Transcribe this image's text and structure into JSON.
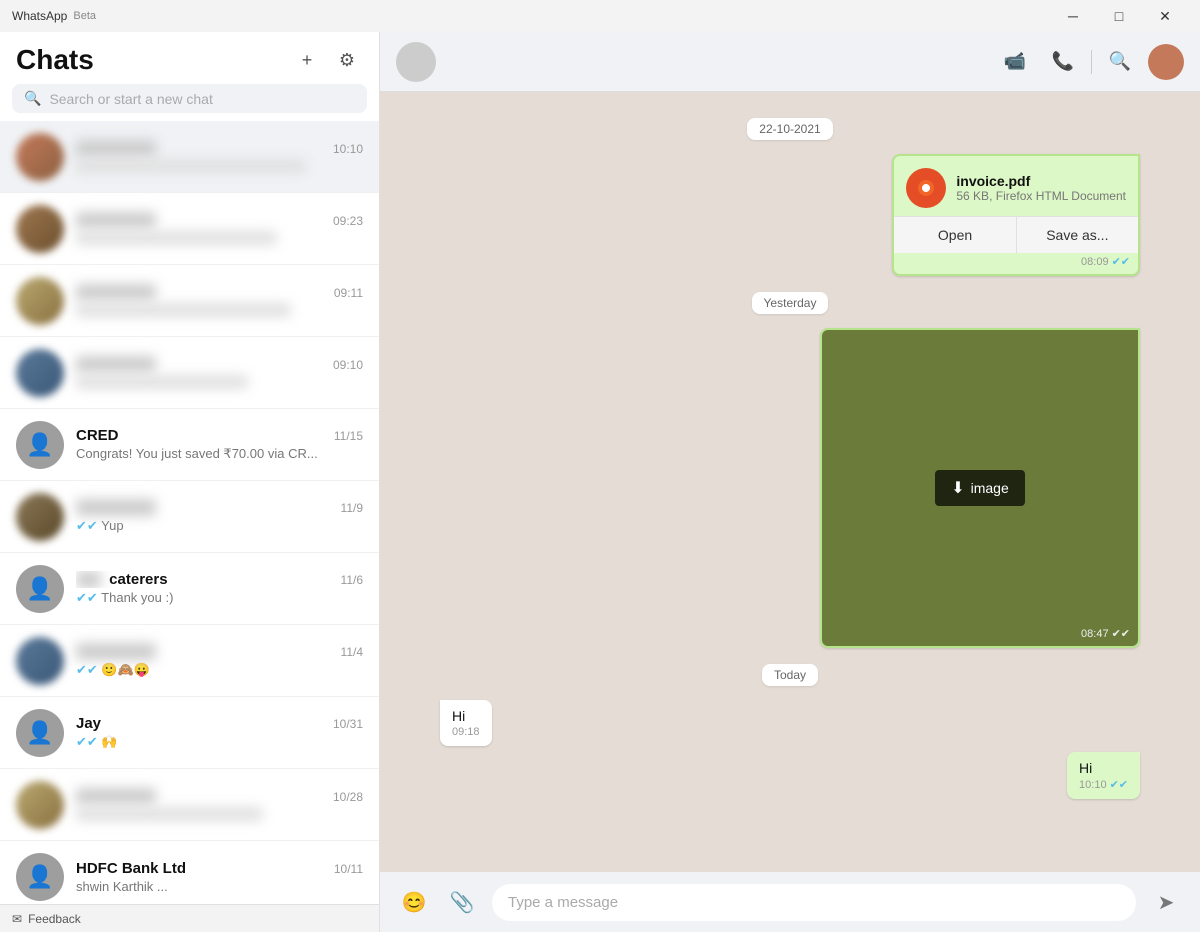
{
  "titlebar": {
    "app_name": "WhatsApp",
    "beta_label": "Beta",
    "minimize_label": "─",
    "maximize_label": "□",
    "close_label": "✕"
  },
  "sidebar": {
    "title": "Chats",
    "search_placeholder": "Search or start a new chat",
    "add_button_label": "+",
    "settings_button_label": "⚙"
  },
  "chat_list": [
    {
      "id": "chat-1",
      "name": "",
      "time": "10:10",
      "preview": "",
      "avatar_type": "blurred",
      "active": true
    },
    {
      "id": "chat-2",
      "name": "",
      "time": "09:23",
      "preview": "",
      "avatar_type": "blurred2",
      "active": false
    },
    {
      "id": "chat-3",
      "name": "",
      "time": "09:11",
      "preview": "",
      "avatar_type": "blurred3",
      "active": false
    },
    {
      "id": "chat-4",
      "name": "",
      "time": "09:10",
      "preview": "",
      "avatar_type": "blurred4",
      "active": false
    },
    {
      "id": "chat-cred",
      "name": "CRED",
      "time": "11/15",
      "preview": "Congrats! You just saved ₹70.00 via CR...",
      "avatar_type": "gray",
      "active": false
    },
    {
      "id": "chat-5",
      "name": "",
      "time": "11/9",
      "preview": "✔✔ Yup",
      "avatar_type": "blurred5",
      "active": false
    },
    {
      "id": "chat-caterers",
      "name": "caterers",
      "time": "11/6",
      "preview": "✔✔ Thank you :)",
      "avatar_type": "gray",
      "active": false
    },
    {
      "id": "chat-6",
      "name": "",
      "time": "11/4",
      "preview": "✔✔ 🙂🙈😛",
      "avatar_type": "blurred4",
      "active": false
    },
    {
      "id": "chat-jay",
      "name": "Jay",
      "time": "10/31",
      "preview": "✔✔ 🙌",
      "avatar_type": "gray",
      "active": false
    },
    {
      "id": "chat-7",
      "name": "",
      "time": "10/28",
      "preview": "",
      "avatar_type": "blurred3",
      "active": false
    },
    {
      "id": "chat-hdfc",
      "name": "HDFC Bank Ltd",
      "time": "10/11",
      "preview": "shwin Karthik ...",
      "avatar_type": "gray",
      "active": false
    }
  ],
  "date_labels": {
    "date1": "22-10-2021",
    "yesterday": "Yesterday",
    "today": "Today"
  },
  "messages": {
    "file_msg": {
      "filename": "invoice.pdf",
      "filesize": "56 KB, Firefox HTML Document",
      "open_label": "Open",
      "save_label": "Save as...",
      "time": "08:09"
    },
    "image_msg": {
      "label": "image",
      "time": "08:47"
    },
    "incoming_hi": {
      "text": "Hi",
      "time": "09:18"
    },
    "outgoing_hi": {
      "text": "Hi",
      "time": "10:10"
    }
  },
  "input": {
    "placeholder": "Type a message",
    "emoji_icon": "😊",
    "attach_icon": "📎",
    "send_icon": "➤"
  },
  "header_icons": {
    "video_icon": "📹",
    "phone_icon": "📞",
    "search_icon": "🔍"
  },
  "feedback": {
    "icon": "✉",
    "label": "Feedback"
  }
}
